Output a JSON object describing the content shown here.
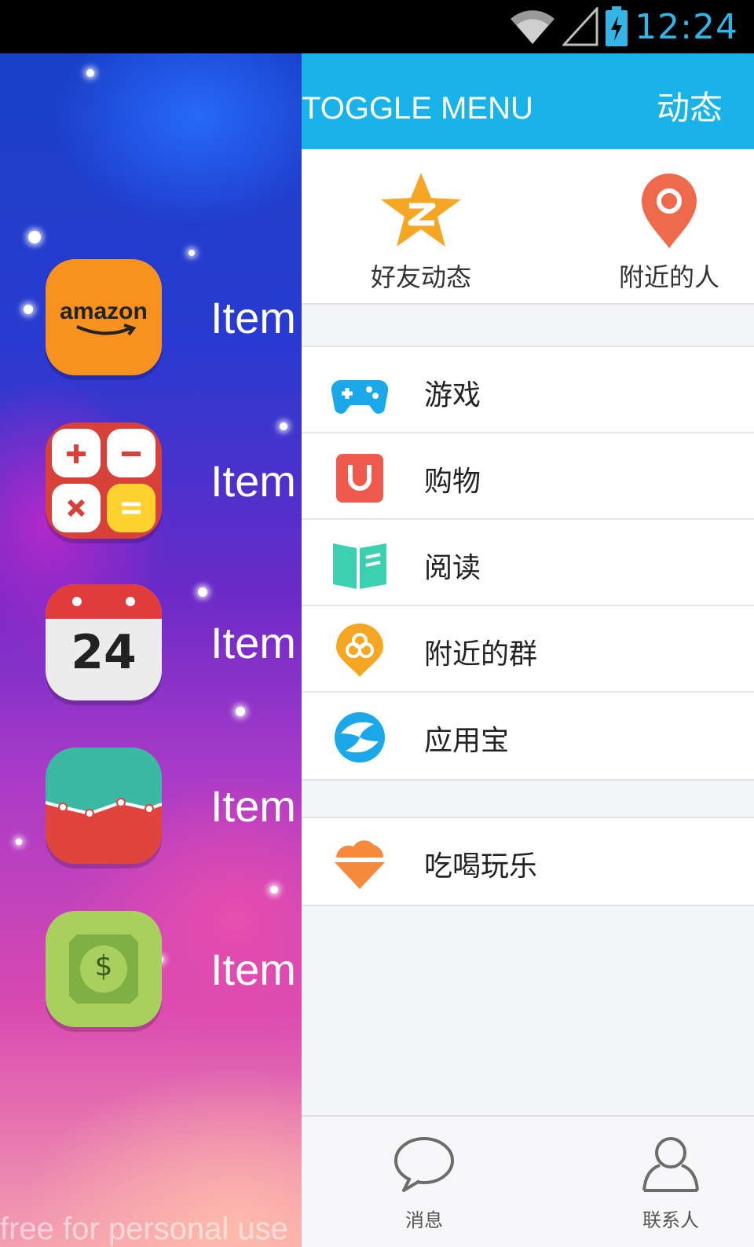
{
  "status_bar": {
    "time": "12:24"
  },
  "left_list": {
    "items": [
      {
        "label": "Item",
        "icon": "amazon-app-icon",
        "icon_text": "amazon"
      },
      {
        "label": "Item",
        "icon": "calculator-app-icon"
      },
      {
        "label": "Item",
        "icon": "calendar-app-icon",
        "icon_text": "24"
      },
      {
        "label": "Item",
        "icon": "chart-app-icon"
      },
      {
        "label": "Item",
        "icon": "money-app-icon",
        "icon_text": "$"
      }
    ],
    "watermark": "free for personal use"
  },
  "drawer": {
    "toolbar": {
      "title": "TOGGLE MENU",
      "action": "动态"
    },
    "quick_actions": [
      {
        "label": "好友动态",
        "icon": "qzone-star-icon",
        "color": "#f5a623"
      },
      {
        "label": "附近的人",
        "icon": "location-pin-icon",
        "color": "#ef6a4c"
      }
    ],
    "menu_primary": [
      {
        "label": "游戏",
        "icon": "gamepad-icon",
        "color": "#1aa8e8"
      },
      {
        "label": "购物",
        "icon": "shopping-bag-icon",
        "color": "#ef5a4c"
      },
      {
        "label": "阅读",
        "icon": "book-icon",
        "color": "#3ccfb0"
      },
      {
        "label": "附近的群",
        "icon": "nearby-group-icon",
        "color": "#f5a623"
      },
      {
        "label": "应用宝",
        "icon": "app-store-icon",
        "color": "#1aa8e8"
      }
    ],
    "menu_secondary": [
      {
        "label": "吃喝玩乐",
        "icon": "ice-cream-icon",
        "color": "#f58a3c"
      }
    ],
    "tabs": [
      {
        "label": "消息",
        "icon": "message-bubble-icon"
      },
      {
        "label": "联系人",
        "icon": "contacts-person-icon"
      }
    ]
  }
}
